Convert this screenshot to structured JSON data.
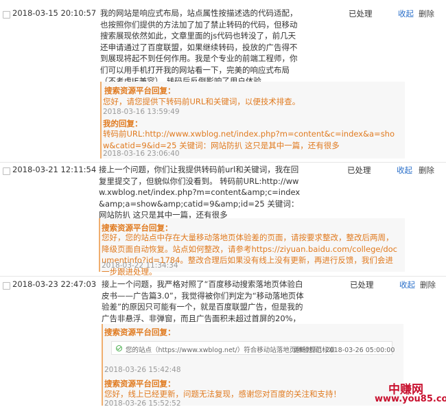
{
  "messages": [
    {
      "timestamp": "2018-03-15 20:10:57",
      "content": "我的网站是响应式布局，站点属性按描述选的代码适配，也按照你们提供的方法加了加了禁止转码的代码，但移动搜索展现依然如此，文章里面的js代码也转没了，前几天还申请通过了百度联盟，如果继续转码，投放的广告得不到展现将起不到任何作用。我是个专业的前端工程师，你们可以用手机打开我的网站看一下，完美的响应式布局（不考虑IE兼容），转码后反倒影响了用户体验。",
      "status": "已处理",
      "fold_label": "收起",
      "delete_label": "删除",
      "replies": [
        {
          "author": "搜索资源平台回复：",
          "text": "您好，请您提供下转码前URL和关键词，以便技术排查。",
          "time": "2018-03-16 13:59:49"
        },
        {
          "author": "我的回复：",
          "text": "转码前URL:http://www.xwblog.net/index.php?m=content&c=index&a=show&catid=9&id=25 关键词：网站防扒 这只是其中一篇，还有很多",
          "time": "2018-03-16 23:06:40"
        }
      ]
    },
    {
      "timestamp": "2018-03-21 12:11:54",
      "content": "接上一个问题，你们让我提供转码前url和关键词，我在回复里提交了，但貌似你们没看到。 转码前URL:http://www.xwblog.net/index.php?m=content&amp;c=index&amp;a=show&amp;catid=9&amp;id=25 关键词：网站防扒 这只是其中一篇，还有很多",
      "status": "已处理",
      "fold_label": "收起",
      "delete_label": "删除",
      "replies": [
        {
          "author": "搜索资源平台回复：",
          "text": "您好，您的站点中存在大量移动落地页体验差的页面，请按要求整改，整改后两周，降级页面自动恢复。站点如何整改，请参考https://ziyuan.baidu.com/college/documentinfo?id=1784。整改合理后如果没有线上没有更新，再进行反馈，我们会进一步跟进处理。",
          "time": "2018-03-22 11:34:34"
        }
      ]
    },
    {
      "timestamp": "2018-03-23 22:47:03",
      "content": "接上一个问题，我严格对照了“百度移动搜索落地页体验白皮书——广告篇3.0”，我觉得被你们判定为“移动落地页体验差”的原因只可能有一个，就是百度联盟广告，但是我的广告非悬浮、非弹窗，而且广告面积未超过首屏的20%，请你们重新审查。",
      "status": "已处理",
      "fold_label": "收起",
      "delete_label": "删除",
      "replies": [
        {
          "author": "搜索资源平台回复：",
          "notice_text": "您的站点（https://www.xwblog.net/）符合移动站落地页体验规范标准",
          "notice_time": "更新时间：2018-03-26 05:00:00",
          "time": "2018-03-26 15:42:48"
        },
        {
          "author": "搜索资源平台回复：",
          "text": "您好，线上已经更新，问题无法复现，感谢您对百度的关注和支持！",
          "time": "2018-03-26 15:52:52"
        }
      ]
    }
  ],
  "watermark": {
    "site_name": "中赚网",
    "url": "www.you85.com"
  }
}
